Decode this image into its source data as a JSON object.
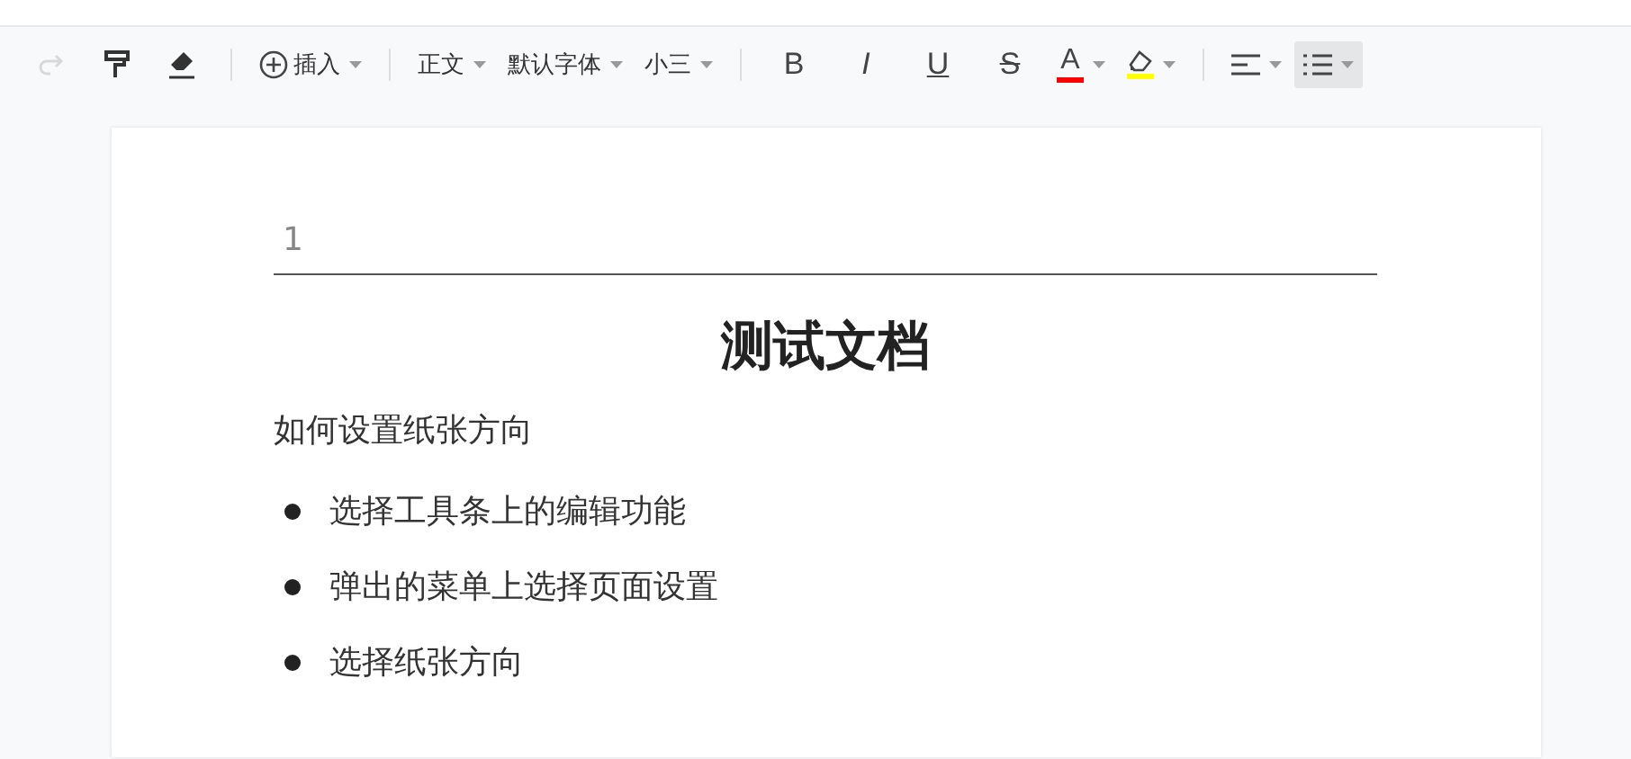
{
  "toolbar": [
    {
      "kind": "redo",
      "disabled": true
    },
    {
      "kind": "format-painter",
      "disabled": false
    },
    {
      "kind": "eraser",
      "disabled": false
    },
    {
      "kind": "separator"
    },
    {
      "kind": "insert",
      "label": "插入"
    },
    {
      "kind": "separator"
    },
    {
      "kind": "dropdown",
      "label": "正文"
    },
    {
      "kind": "dropdown",
      "label": "默认字体"
    },
    {
      "kind": "dropdown",
      "label": "小三"
    },
    {
      "kind": "separator"
    },
    {
      "kind": "bold",
      "label": "B"
    },
    {
      "kind": "italic",
      "label": "I"
    },
    {
      "kind": "underline",
      "label": "U"
    },
    {
      "kind": "strike",
      "label": "S"
    },
    {
      "kind": "font-color",
      "label": "A",
      "color": "#ff0000"
    },
    {
      "kind": "highlight",
      "color": "#ffff00"
    },
    {
      "kind": "separator"
    },
    {
      "kind": "align",
      "selected": false
    },
    {
      "kind": "list",
      "selected": true
    }
  ],
  "document": {
    "header": "1",
    "title": "测试文档",
    "paragraph": "如何设置纸张方向",
    "bullets": [
      "选择工具条上的编辑功能",
      "弹出的菜单上选择页面设置",
      "选择纸张方向"
    ]
  }
}
